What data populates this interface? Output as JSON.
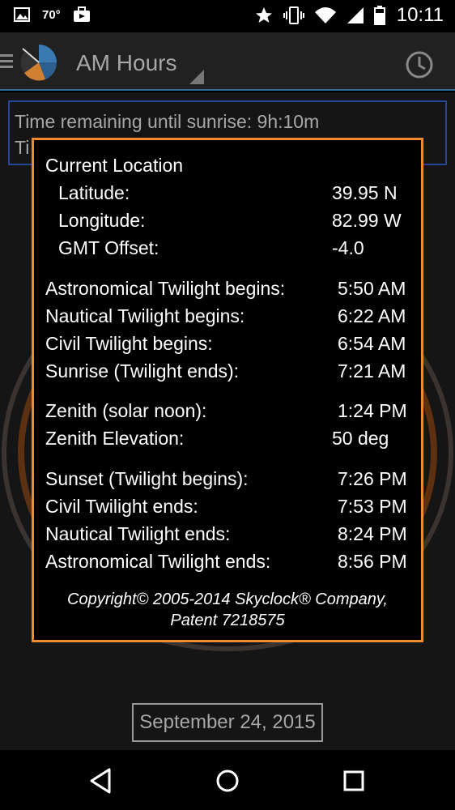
{
  "status_bar": {
    "temperature": "70°",
    "time": "10:11",
    "icons": [
      "image-icon",
      "briefcase-icon",
      "star-icon",
      "vibrate-icon",
      "wifi-icon",
      "signal-icon",
      "battery-icon"
    ]
  },
  "app_bar": {
    "title": "AM Hours",
    "icons": [
      "menu-icon",
      "app-logo-icon",
      "history-clock-icon"
    ]
  },
  "info_box": {
    "line1": "Time remaining until sunrise:  9h:10m",
    "line2": "Ti"
  },
  "popup": {
    "header": "Current Location",
    "location": [
      {
        "label": "Latitude:",
        "value": "39.95 N"
      },
      {
        "label": "Longitude:",
        "value": "82.99 W"
      },
      {
        "label": "GMT Offset:",
        "value": "-4.0"
      }
    ],
    "morning": [
      {
        "label": "Astronomical Twilight begins:",
        "value": "5:50 AM"
      },
      {
        "label": "Nautical Twilight begins:",
        "value": "6:22 AM"
      },
      {
        "label": "Civil Twilight begins:",
        "value": "6:54 AM"
      },
      {
        "label": "Sunrise (Twilight ends):",
        "value": "7:21 AM"
      }
    ],
    "zenith": [
      {
        "label": "Zenith (solar noon):",
        "value": "1:24 PM"
      },
      {
        "label": "Zenith Elevation:",
        "value": "50 deg"
      }
    ],
    "evening": [
      {
        "label": "Sunset (Twilight begins):",
        "value": "7:26 PM"
      },
      {
        "label": "Civil Twilight ends:",
        "value": "7:53 PM"
      },
      {
        "label": "Nautical Twilight ends:",
        "value": "8:24 PM"
      },
      {
        "label": "Astronomical Twilight ends:",
        "value": "8:56 PM"
      }
    ],
    "copyright_line1": "Copyright© 2005-2014 Skyclock® Company,",
    "copyright_line2": "Patent 7218575"
  },
  "date_button": "September 24, 2015",
  "nav_bar": {
    "icons": [
      "back-icon",
      "home-icon",
      "recents-icon"
    ]
  },
  "colors": {
    "popup_border": "#f08a2c",
    "info_border": "#23469a",
    "appbar_divider": "#2a6e9e"
  }
}
